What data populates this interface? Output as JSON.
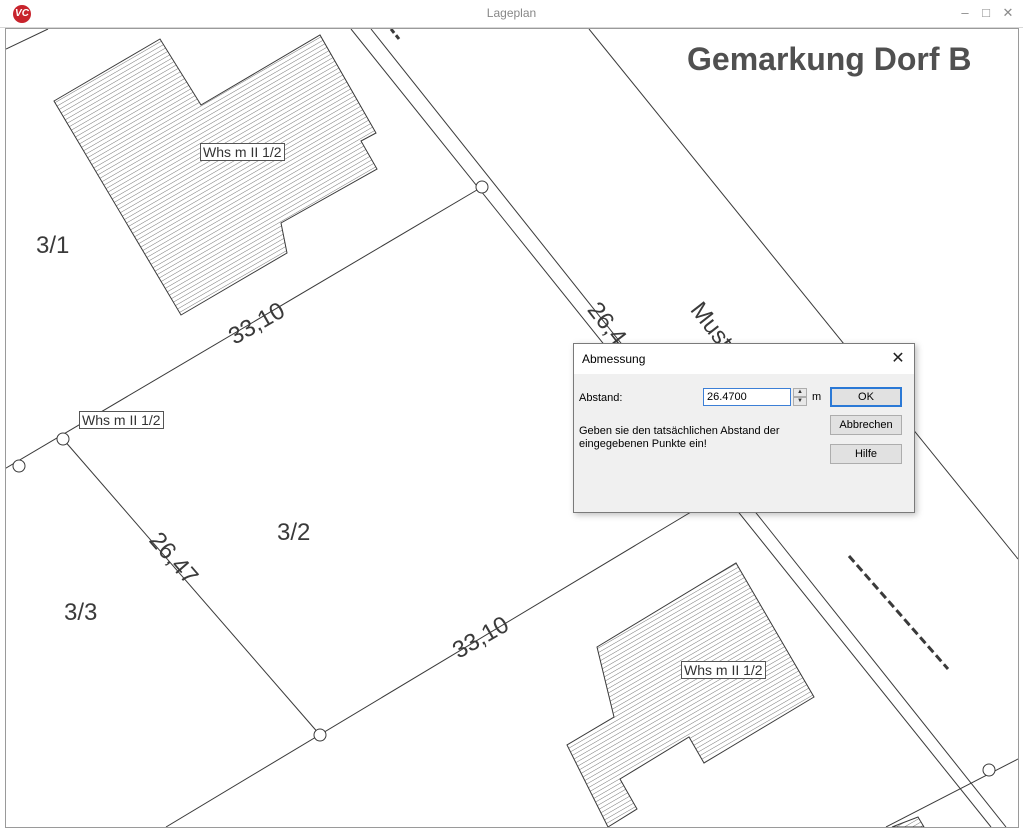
{
  "window": {
    "title": "Lageplan",
    "logo": "VC",
    "minimize_icon": "–",
    "maximize_icon": "□",
    "close_icon": "✕"
  },
  "map": {
    "gemarkung": "Gemarkung Dorf B",
    "parcels": [
      "3/1",
      "3/2",
      "3/3"
    ],
    "building_labels": [
      "Whs m  II 1/2",
      "Whs m  II 1/2",
      "Whs m  II 1/2"
    ],
    "measures": [
      "33,10",
      "33,10",
      "26,47",
      "26,4",
      "Must"
    ]
  },
  "dialog": {
    "title": "Abmessung",
    "close_icon": "✕",
    "field_label": "Abstand:",
    "field_value": "26.4700",
    "unit": "m",
    "message": "Geben sie den tatsächlichen Abstand der eingegebenen Punkte ein!",
    "ok_label": "OK",
    "cancel_label": "Abbrechen",
    "help_label": "Hilfe"
  },
  "colors": {
    "accent": "#2b79d6",
    "brand": "#c8232c",
    "line": "#3a3a3a"
  }
}
